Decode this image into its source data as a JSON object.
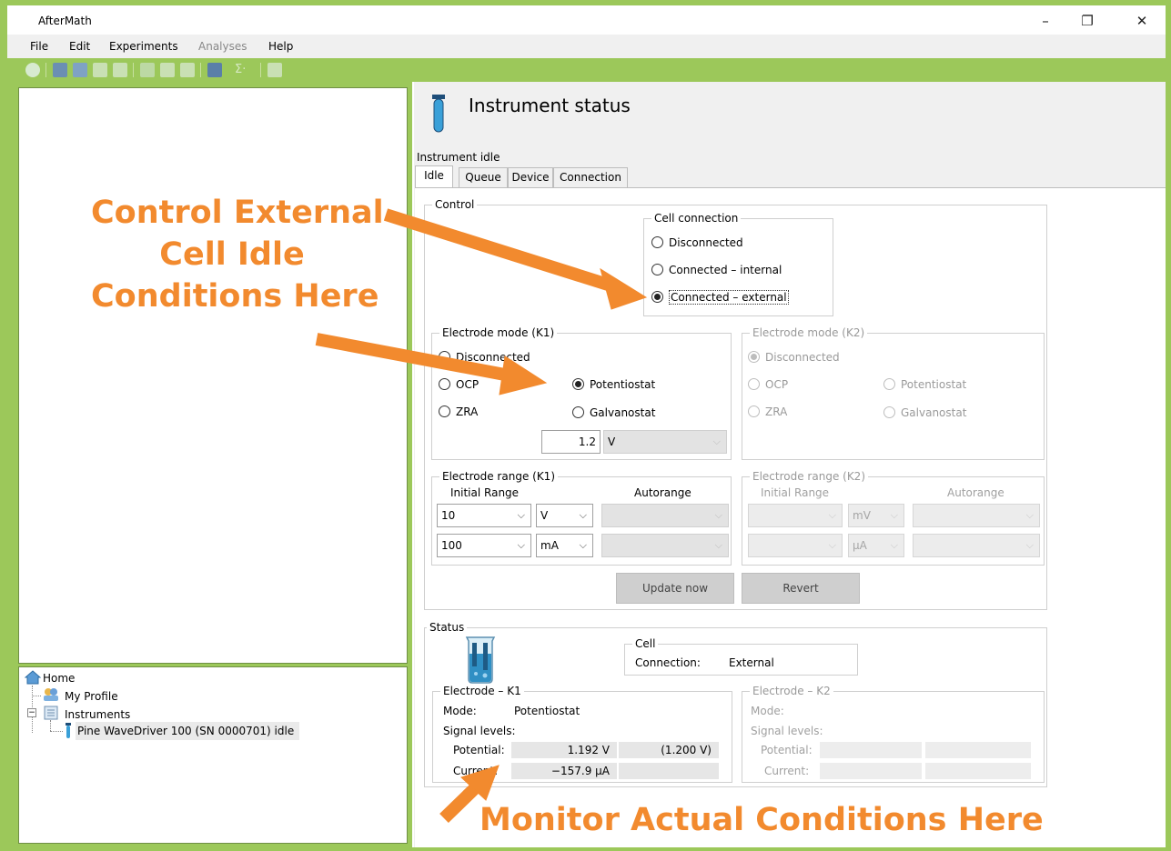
{
  "window": {
    "title": "AfterMath",
    "minimize_label": "–",
    "maximize_label": "❐",
    "close_label": "✕"
  },
  "menu": {
    "file": "File",
    "edit": "Edit",
    "experiments": "Experiments",
    "analyses": "Analyses",
    "help": "Help"
  },
  "toolbar": {
    "icons": [
      "back-icon",
      "home-settings-icon",
      "home-icon",
      "save-icon",
      "print-icon",
      "cut-icon",
      "copy-icon",
      "paste-icon",
      "experiment-icon",
      "sum-icon",
      "chart-icon"
    ]
  },
  "tree": {
    "home": "Home",
    "profile": "My Profile",
    "instruments": "Instruments",
    "device": "Pine WaveDriver 100 (SN 0000701) idle"
  },
  "status_panel": {
    "title": "Instrument status",
    "subtitle": "Instrument idle",
    "tabs": [
      "Idle",
      "Queue",
      "Device",
      "Connection"
    ],
    "control_label": "Control",
    "cell_connection": {
      "label": "Cell connection",
      "options": [
        "Disconnected",
        "Connected – internal",
        "Connected – external"
      ],
      "selected": "Connected – external"
    },
    "electrode_mode_k1": {
      "label": "Electrode mode (K1)",
      "disconnected": "Disconnected",
      "ocp": "OCP",
      "zra": "ZRA",
      "potentiostat": "Potentiostat",
      "galvanostat": "Galvanostat",
      "selected": "Potentiostat",
      "value": "1.2",
      "unit": "V"
    },
    "electrode_mode_k2": {
      "label": "Electrode mode (K2)",
      "disconnected": "Disconnected",
      "ocp": "OCP",
      "zra": "ZRA",
      "potentiostat": "Potentiostat",
      "galvanostat": "Galvanostat",
      "selected": "Disconnected"
    },
    "electrode_range_k1": {
      "label": "Electrode range (K1)",
      "initial_range": "Initial Range",
      "autorange": "Autorange",
      "potential_value": "10",
      "potential_unit": "V",
      "current_value": "100",
      "current_unit": "mA"
    },
    "electrode_range_k2": {
      "label": "Electrode range (K2)",
      "initial_range": "Initial Range",
      "autorange": "Autorange",
      "potential_unit": "mV",
      "current_unit": "µA"
    },
    "update_button": "Update now",
    "revert_button": "Revert",
    "status_label": "Status",
    "cell": {
      "label": "Cell",
      "connection_label": "Connection:",
      "connection_value": "External"
    },
    "electrode_k1": {
      "label": "Electrode – K1",
      "mode_label": "Mode:",
      "mode_value": "Potentiostat",
      "signal_levels": "Signal levels:",
      "potential_label": "Potential:",
      "potential_value": "1.192 V",
      "potential_setpoint": "(1.200 V)",
      "current_label": "Current:",
      "current_value": "−157.9 µA"
    },
    "electrode_k2": {
      "label": "Electrode – K2",
      "mode_label": "Mode:",
      "signal_levels": "Signal levels:",
      "potential_label": "Potential:",
      "current_label": "Current:"
    }
  },
  "annotations": {
    "top_line1": "Control External",
    "top_line2": "Cell Idle",
    "top_line3": "Conditions Here",
    "bottom": "Monitor Actual Conditions Here",
    "color": "#f28a2e"
  }
}
